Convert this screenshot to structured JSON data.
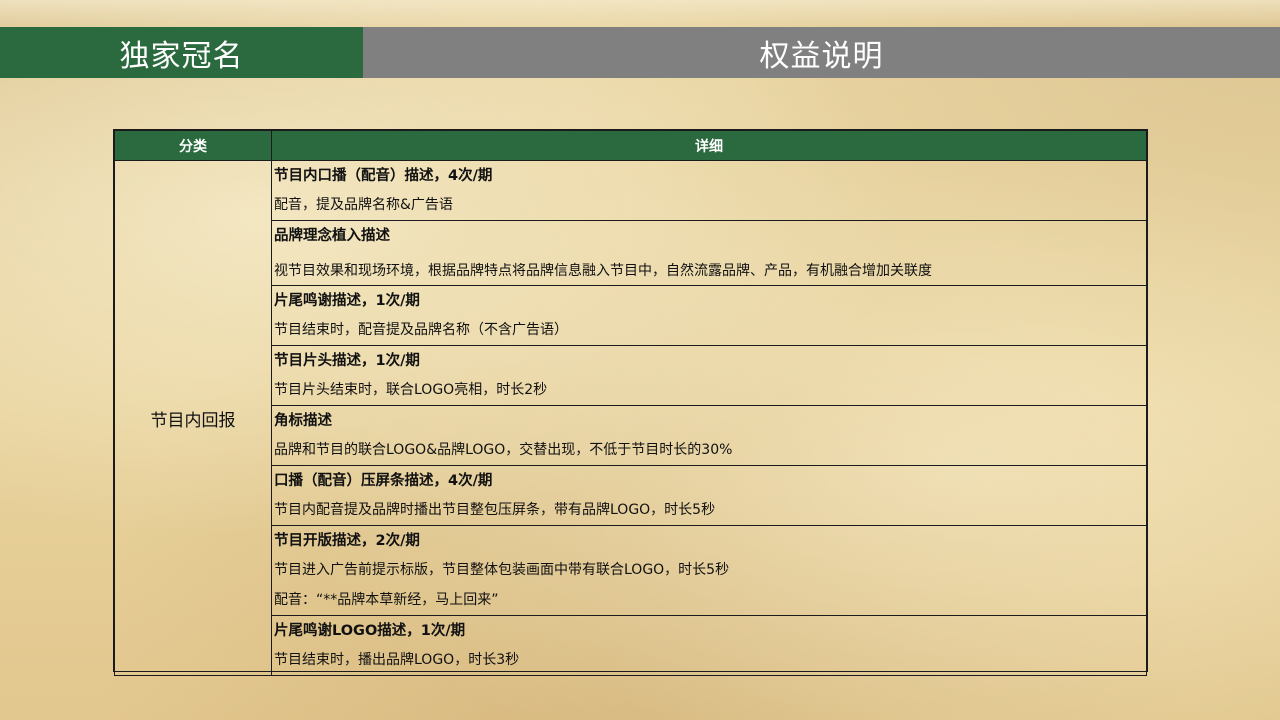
{
  "header": {
    "left_title": "独家冠名",
    "right_title": "权益说明"
  },
  "table": {
    "columns": [
      "分类",
      "详细"
    ],
    "category": "节目内回报",
    "items": [
      {
        "title": "节目内口播（配音）描述，4次/期",
        "lines": [
          "配音，提及品牌名称&广告语"
        ]
      },
      {
        "title": "品牌理念植入描述",
        "lines": [
          "视节目效果和现场环境，根据品牌特点将品牌信息融入节目中，自然流露品牌、产品，有机融合增加关联度"
        ]
      },
      {
        "title": "片尾鸣谢描述，1次/期",
        "lines": [
          "节目结束时，配音提及品牌名称（不含广告语）"
        ]
      },
      {
        "title": "节目片头描述，1次/期",
        "lines": [
          "节目片头结束时，联合LOGO亮相，时长2秒"
        ]
      },
      {
        "title": "角标描述",
        "lines": [
          "品牌和节目的联合LOGO&品牌LOGO，交替出现，不低于节目时长的30%"
        ]
      },
      {
        "title": "口播（配音）压屏条描述，4次/期",
        "lines": [
          "节目内配音提及品牌时播出节目整包压屏条，带有品牌LOGO，时长5秒"
        ]
      },
      {
        "title": "节目开版描述，2次/期",
        "lines": [
          "节目进入广告前提示标版，节目整体包装画面中带有联合LOGO，时长5秒",
          "配音：“**品牌本草新经，马上回来”"
        ]
      },
      {
        "title": "片尾鸣谢LOGO描述，1次/期",
        "lines": [
          "节目结束时，播出品牌LOGO，时长3秒"
        ]
      }
    ]
  }
}
